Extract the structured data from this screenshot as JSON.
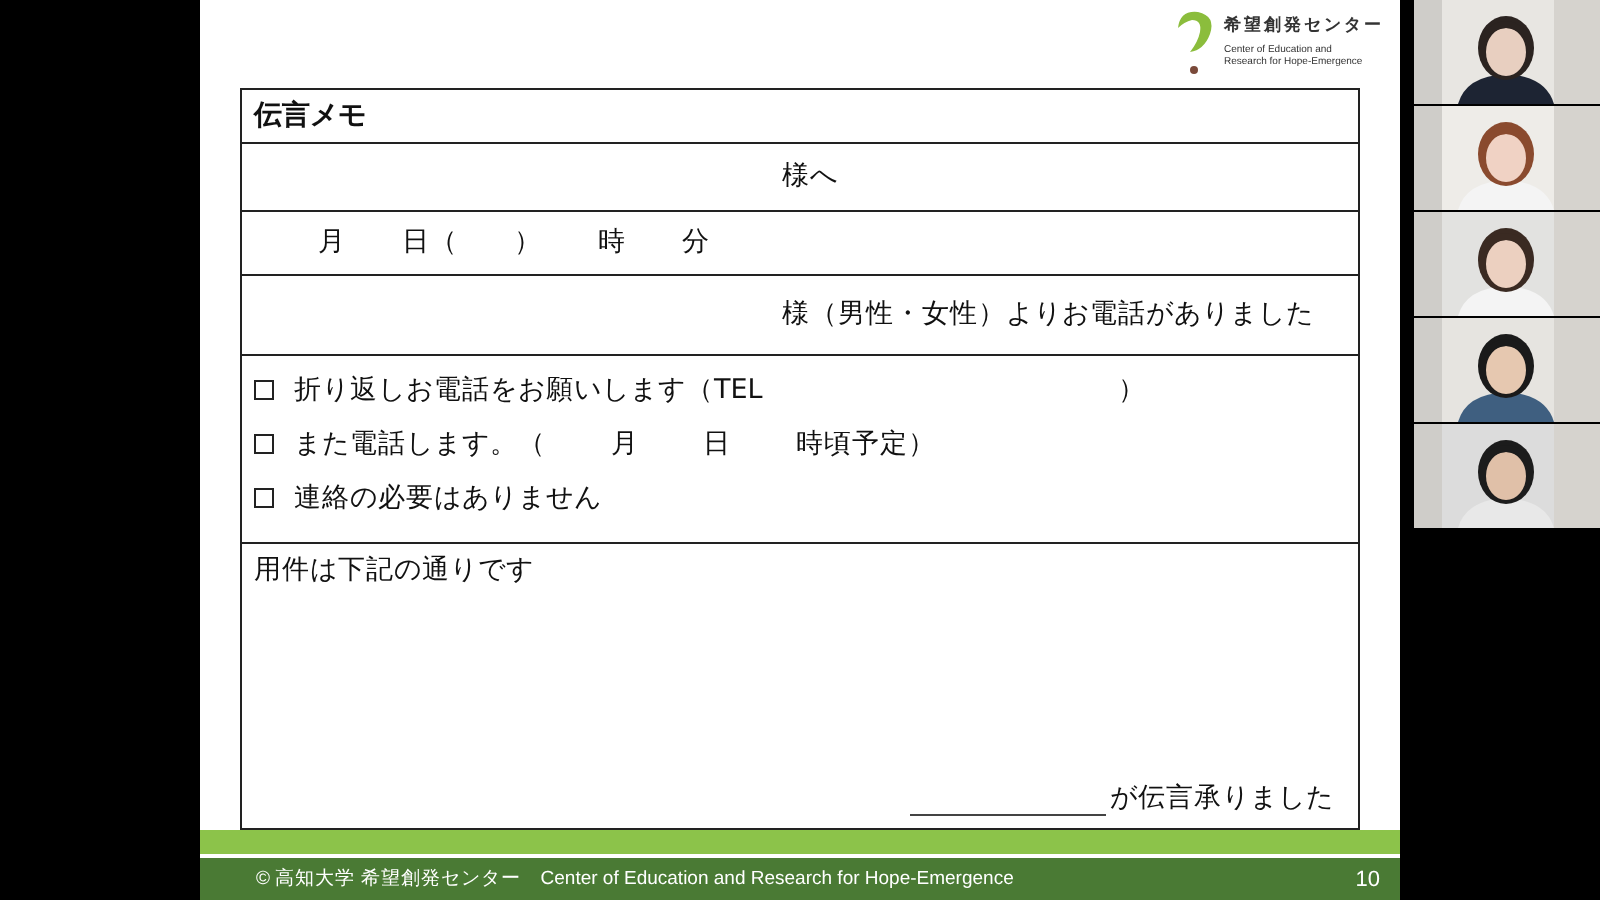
{
  "slide": {
    "logo": {
      "name": "希望創発センター",
      "subtitle_lines": [
        "Center of Education and",
        "Research for Hope-Emergence"
      ]
    },
    "memo": {
      "title": "伝言メモ",
      "recipient": "様へ",
      "datetime": "月　　日（　　）　　時　　分",
      "caller": "様（男性・女性）よりお電話がありました",
      "options": [
        {
          "label": "折り返しお電話をお願いします（TEL",
          "closing": "）",
          "checked": false
        },
        {
          "label": "また電話します。（　　 月　　 日　　 時頃予定）",
          "checked": false
        },
        {
          "label": "連絡の必要はありません",
          "checked": false
        }
      ],
      "message_label": "用件は下記の通りです",
      "taker_suffix": "が伝言承りました"
    },
    "footer": {
      "credit": "© 高知大学 希望創発センター　Center of Education and Research for Hope-Emergence",
      "page": "10"
    }
  }
}
